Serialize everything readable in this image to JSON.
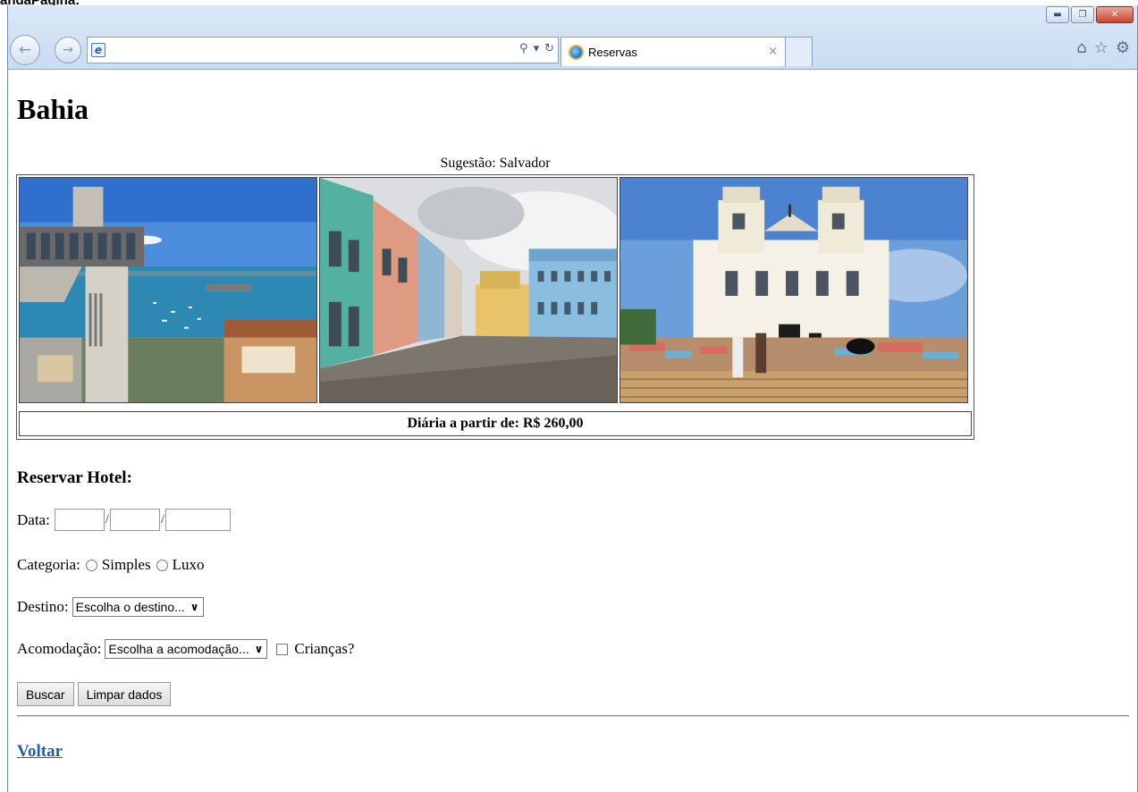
{
  "caption": "andaPagina:",
  "browser": {
    "tab_title": "Reservas",
    "tab_close": "×",
    "window_buttons": [
      "minimize-icon",
      "restore-icon",
      "close-icon"
    ],
    "toolbar_icons": [
      "home-icon",
      "favorites-star-icon",
      "settings-gear-icon"
    ]
  },
  "page": {
    "title": "Bahia",
    "suggestion": "Sugestão: Salvador",
    "price": "Diária a partir de: R$ 260,00",
    "photos": [
      "elevador-lacerda-photo",
      "pelourinho-photo",
      "bonfim-church-photo"
    ]
  },
  "form": {
    "title": "Reservar Hotel:",
    "date_label": "Data:",
    "date_sep": "/",
    "category_label": "Categoria:",
    "category_options": [
      "Simples",
      "Luxo"
    ],
    "destination_label": "Destino:",
    "destination_select": "Escolha o destino...",
    "accommodation_label": "Acomodação:",
    "accommodation_select": "Escolha a acomodação...",
    "children_label": "Crianças?",
    "search_button": "Buscar",
    "clear_button": "Limpar dados"
  },
  "back_link": "Voltar"
}
